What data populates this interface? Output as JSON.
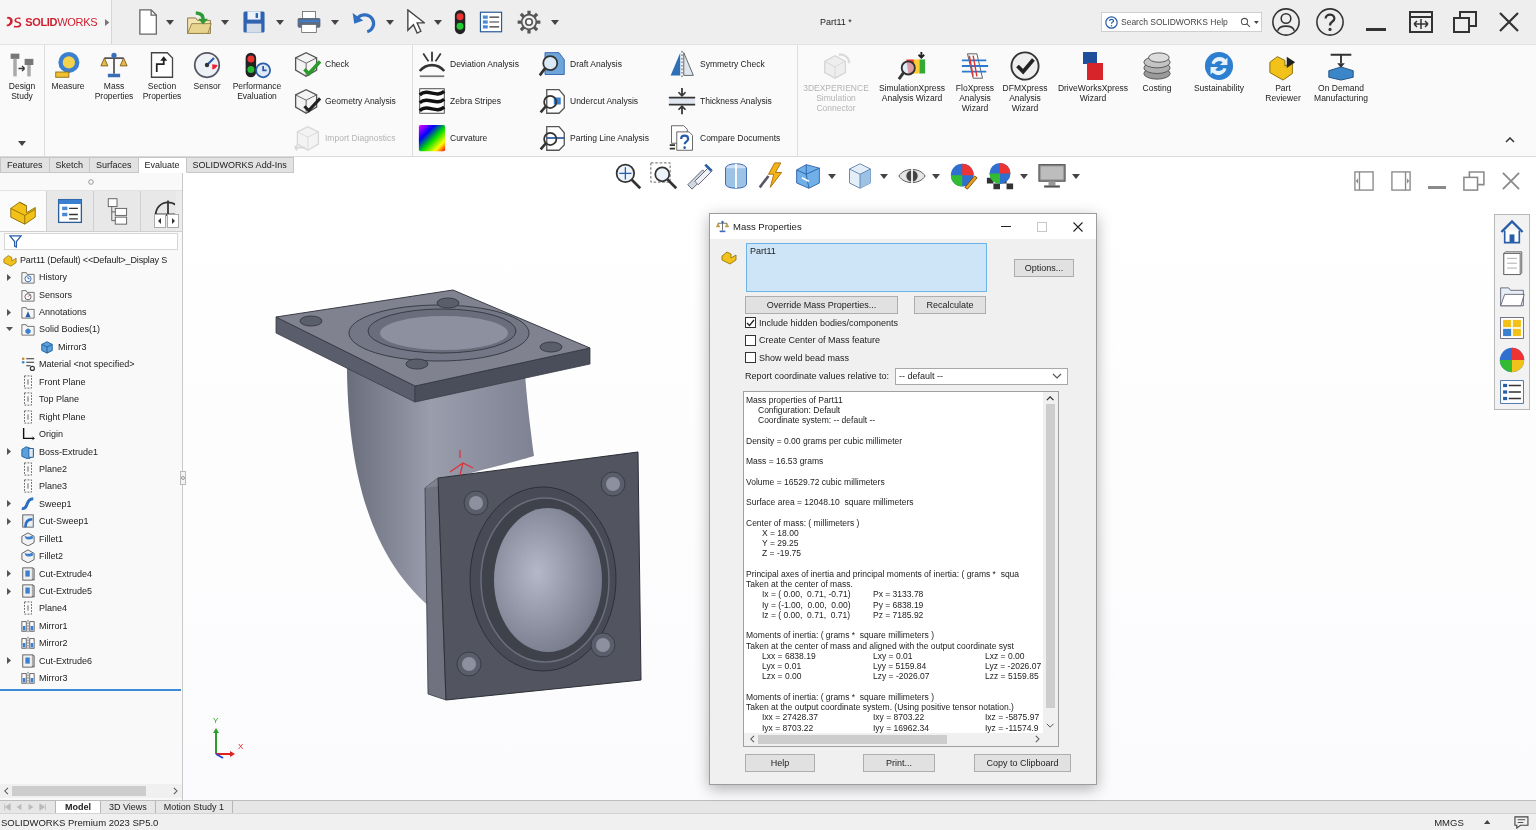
{
  "app": {
    "logo": "**SOLID**WORKS",
    "document_title": "Part11 *"
  },
  "quick_access": [
    {
      "dropdown": true
    },
    {
      "dropdown": true
    },
    {
      "dropdown": true
    },
    {
      "dropdown": true
    },
    {
      "dropdown": true
    },
    {
      "dropdown": true
    },
    {
      "dropdown": false
    },
    {
      "dropdown": false
    },
    {
      "dropdown": true
    }
  ],
  "search": {
    "placeholder": "Search SOLIDWORKS Help"
  },
  "ribbon": {
    "design_study": {
      "label": "Design Study",
      "disabled": false
    },
    "large_tools": [
      {
        "label": "Measure",
        "disabled": false
      },
      {
        "label": "Mass Properties",
        "disabled": false
      },
      {
        "label": "Section Properties",
        "disabled": false
      },
      {
        "label": "Sensor",
        "disabled": false
      },
      {
        "label": "Performance Evaluation",
        "disabled": false
      }
    ],
    "check_tools": [
      {
        "label": "Check",
        "disabled": false
      },
      {
        "label": "Geometry Analysis",
        "disabled": false
      },
      {
        "label": "Import Diagnostics",
        "disabled": true
      }
    ],
    "analysis_columns": [
      {
        "tools": [
          {
            "label": "Deviation Analysis",
            "disabled": false
          },
          {
            "label": "Zebra Stripes",
            "disabled": false
          },
          {
            "label": "Curvature",
            "disabled": false
          }
        ]
      },
      {
        "tools": [
          {
            "label": "Draft Analysis",
            "disabled": false
          },
          {
            "label": "Undercut Analysis",
            "disabled": false
          },
          {
            "label": "Parting Line Analysis",
            "disabled": false
          }
        ]
      },
      {
        "tools": [
          {
            "label": "Symmetry Check",
            "disabled": false
          },
          {
            "label": "Thickness Analysis",
            "disabled": false
          },
          {
            "label": "Compare Documents",
            "disabled": false
          }
        ]
      }
    ],
    "addin_tools": [
      {
        "label": "3DEXPERIENCE Simulation Connector",
        "disabled": true
      },
      {
        "label": "SimulationXpress Analysis Wizard",
        "disabled": false
      },
      {
        "label": "FloXpress Analysis Wizard",
        "disabled": false
      },
      {
        "label": "DFMXpress Analysis Wizard",
        "disabled": false
      },
      {
        "label": "DriveWorksXpress Wizard",
        "disabled": false
      },
      {
        "label": "Costing",
        "disabled": false
      },
      {
        "label": "Sustainability",
        "disabled": false
      },
      {
        "label": "Part Reviewer",
        "disabled": false
      },
      {
        "label": "On Demand Manufacturing",
        "disabled": false
      }
    ]
  },
  "ribbon_tabs": [
    {
      "label": "Features",
      "selected": false
    },
    {
      "label": "Sketch",
      "selected": false
    },
    {
      "label": "Surfaces",
      "selected": false
    },
    {
      "label": "Evaluate",
      "selected": true
    },
    {
      "label": "SOLIDWORKS Add-Ins",
      "selected": false
    }
  ],
  "panel_tabs": [
    {
      "selected": true
    },
    {
      "selected": false
    },
    {
      "selected": false
    },
    {
      "selected": false
    }
  ],
  "tree": {
    "root": {
      "label": "Part11 (Default) <<Default>_Display S",
      "kind": "part",
      "children": [
        {
          "label": "History",
          "kind": "history",
          "expanded": false
        },
        {
          "label": "Sensors",
          "kind": "sensors"
        },
        {
          "label": "Annotations",
          "kind": "annotations",
          "expanded": false
        },
        {
          "label": "Solid Bodies(1)",
          "kind": "bodies",
          "expanded": true,
          "children": [
            {
              "label": "Mirror3",
              "kind": "body"
            }
          ]
        },
        {
          "label": "Material <not specified>",
          "kind": "material"
        },
        {
          "label": "Front Plane",
          "kind": "plane"
        },
        {
          "label": "Top Plane",
          "kind": "plane"
        },
        {
          "label": "Right Plane",
          "kind": "plane"
        },
        {
          "label": "Origin",
          "kind": "origin"
        },
        {
          "label": "Boss-Extrude1",
          "kind": "boss",
          "expanded": false
        },
        {
          "label": "Plane2",
          "kind": "plane"
        },
        {
          "label": "Plane3",
          "kind": "plane"
        },
        {
          "label": "Sweep1",
          "kind": "sweep",
          "expanded": false
        },
        {
          "label": "Cut-Sweep1",
          "kind": "cutsweep",
          "expanded": false
        },
        {
          "label": "Fillet1",
          "kind": "fillet"
        },
        {
          "label": "Fillet2",
          "kind": "fillet"
        },
        {
          "label": "Cut-Extrude4",
          "kind": "cutextrude",
          "expanded": false
        },
        {
          "label": "Cut-Extrude5",
          "kind": "cutextrude",
          "expanded": false
        },
        {
          "label": "Plane4",
          "kind": "plane"
        },
        {
          "label": "Mirror1",
          "kind": "mirror"
        },
        {
          "label": "Mirror2",
          "kind": "mirror"
        },
        {
          "label": "Cut-Extrude6",
          "kind": "cutextrude",
          "expanded": false
        },
        {
          "label": "Mirror3",
          "kind": "mirror"
        }
      ]
    }
  },
  "view_toolbar": [
    {
      "dropdown": false
    },
    {
      "dropdown": false
    },
    {
      "dropdown": false
    },
    {
      "dropdown": false
    },
    {
      "dropdown": false
    },
    {
      "dropdown": true
    },
    {
      "dropdown": true
    },
    {
      "dropdown": true
    },
    {
      "dropdown": false
    },
    {
      "dropdown": true
    },
    {
      "dropdown": true
    }
  ],
  "triad": {
    "y_label": "Y",
    "x_label": "X"
  },
  "dialog": {
    "title": "Mass Properties",
    "window_buttons": [
      {
        "kind": "minimize",
        "disabled": false
      },
      {
        "kind": "maximize",
        "disabled": true
      },
      {
        "kind": "close",
        "disabled": false
      }
    ],
    "selection": [
      "Part11"
    ],
    "options_button": "Options...",
    "buttons": [
      "Override Mass Properties...",
      "Recalculate"
    ],
    "checkboxes": [
      {
        "label": "Include hidden bodies/components",
        "checked": true
      },
      {
        "label": "Create Center of Mass feature",
        "checked": false
      },
      {
        "label": "Show weld bead mass",
        "checked": false
      }
    ],
    "coordinate_label": "Report coordinate values relative to:",
    "coordinate_value": "-- default --",
    "report": {
      "sections": [
        {
          "lines": [
            {
              "kind": "text",
              "text": "Mass properties of Part11"
            },
            {
              "kind": "indented",
              "text": "Configuration: Default"
            },
            {
              "kind": "indented",
              "text": "Coordinate system: -- default --"
            }
          ]
        },
        {
          "lines": [
            {
              "kind": "text",
              "text": "Density = 0.00 grams per cubic millimeter"
            }
          ]
        },
        {
          "lines": [
            {
              "kind": "text",
              "text": "Mass = 16.53 grams"
            }
          ]
        },
        {
          "lines": [
            {
              "kind": "text",
              "text": "Volume = 16529.72 cubic millimeters"
            }
          ]
        },
        {
          "lines": [
            {
              "kind": "text",
              "text": "Surface area = 12048.10  square millimeters"
            }
          ]
        },
        {
          "lines": [
            {
              "kind": "text",
              "text": "Center of mass: ( millimeters )"
            },
            {
              "kind": "columns",
              "cells": [
                "X = 18.00"
              ]
            },
            {
              "kind": "columns",
              "cells": [
                "Y = 29.25"
              ]
            },
            {
              "kind": "columns",
              "cells": [
                "Z = -19.75"
              ]
            }
          ]
        },
        {
          "lines": [
            {
              "kind": "text",
              "text": "Principal axes of inertia and principal moments of inertia: ( grams *  squa"
            },
            {
              "kind": "text",
              "text": "Taken at the center of mass."
            },
            {
              "kind": "columns",
              "cells": [
                "Ix = ( 0.00,  0.71, -0.71)",
                "Px = 3133.78"
              ]
            },
            {
              "kind": "columns",
              "cells": [
                "Iy = (-1.00,  0.00,  0.00)",
                "Py = 6838.19"
              ]
            },
            {
              "kind": "columns",
              "cells": [
                "Iz = ( 0.00,  0.71,  0.71)",
                "Pz = 7185.92"
              ]
            }
          ]
        },
        {
          "lines": [
            {
              "kind": "text",
              "text": "Moments of inertia: ( grams *  square millimeters )"
            },
            {
              "kind": "text",
              "text": "Taken at the center of mass and aligned with the output coordinate syst"
            },
            {
              "kind": "columns",
              "cells": [
                "Lxx = 6838.19",
                "Lxy = 0.01",
                "Lxz = 0.00"
              ]
            },
            {
              "kind": "columns",
              "cells": [
                "Lyx = 0.01",
                "Lyy = 5159.84",
                "Lyz = -2026.07"
              ]
            },
            {
              "kind": "columns",
              "cells": [
                "Lzx = 0.00",
                "Lzy = -2026.07",
                "Lzz = 5159.85"
              ]
            }
          ]
        },
        {
          "lines": [
            {
              "kind": "text",
              "text": "Moments of inertia: ( grams *  square millimeters )"
            },
            {
              "kind": "text",
              "text": "Taken at the output coordinate system. (Using positive tensor notation.)"
            },
            {
              "kind": "columns",
              "cells": [
                "Ixx = 27428.37",
                "Ixy = 8703.22",
                "Ixz = -5875.97"
              ]
            },
            {
              "kind": "columns",
              "cells": [
                "Iyx = 8703.22",
                "Iyy = 16962.34",
                "Iyz = -11574.9"
              ]
            }
          ]
        }
      ]
    },
    "footer_buttons": [
      "Help",
      "Print...",
      "Copy to Clipboard"
    ]
  },
  "bottom_tabs": [
    {
      "label": "Model",
      "selected": true
    },
    {
      "label": "3D Views",
      "selected": false
    },
    {
      "label": "Motion Study 1",
      "selected": false
    }
  ],
  "status_bar": {
    "product": "SOLIDWORKS Premium 2023 SP5.0",
    "units": "MMGS"
  }
}
